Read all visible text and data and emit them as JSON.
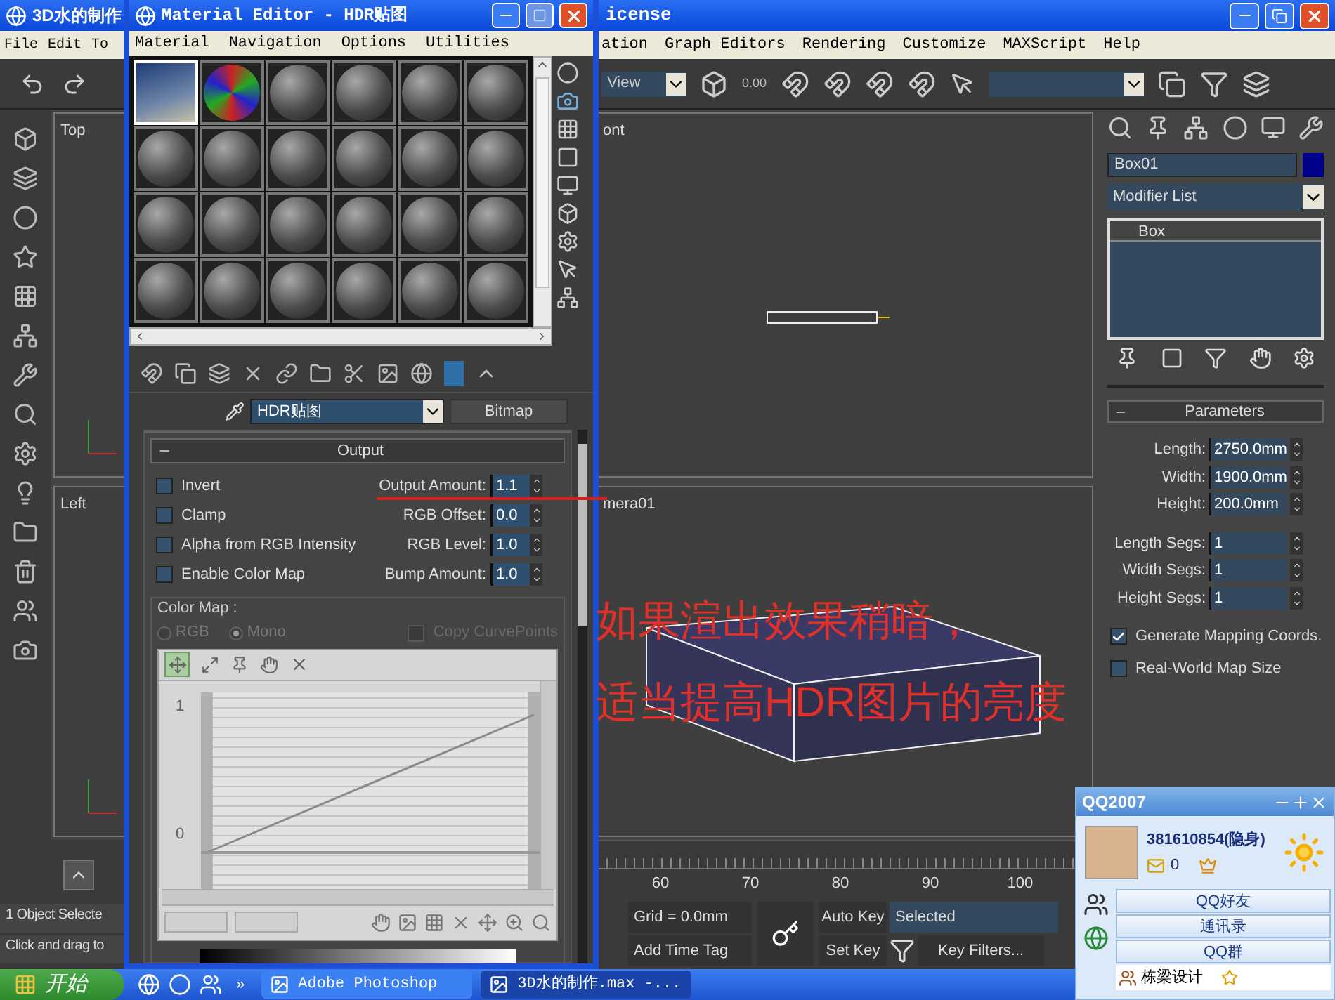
{
  "max_window": {
    "title_left": "3D水的制作",
    "title_right": "icense",
    "menu_left": [
      "File",
      "Edit",
      "To"
    ],
    "menu_right": [
      "ation",
      "Graph Editors",
      "Rendering",
      "Customize",
      "MAXScript",
      "Help"
    ],
    "view_dropdown": "View",
    "snap_value": "0.00"
  },
  "viewports": [
    {
      "label": "Top"
    },
    {
      "label": "ont"
    },
    {
      "label": "Left"
    },
    {
      "label": "mera01"
    }
  ],
  "command_panel": {
    "object_name": "Box01",
    "modifier_list": "Modifier List",
    "stack": [
      {
        "label": "Box",
        "selected": false
      }
    ],
    "rollout": "Parameters",
    "fields": [
      {
        "label": "Length:",
        "value": "2750.0mm"
      },
      {
        "label": "Width:",
        "value": "1900.0mm"
      },
      {
        "label": "Height:",
        "value": "200.0mm"
      },
      {
        "label": "Length Segs:",
        "value": "1"
      },
      {
        "label": "Width Segs:",
        "value": "1"
      },
      {
        "label": "Height Segs:",
        "value": "1"
      }
    ],
    "options": [
      {
        "label": "Generate Mapping Coords.",
        "checked": true
      },
      {
        "label": "Real-World Map Size",
        "checked": false
      }
    ]
  },
  "timeline": {
    "ticks": [
      "60",
      "70",
      "80",
      "90",
      "100"
    ]
  },
  "status": {
    "selection": "1 Object Selecte",
    "prompt": "Click and drag to",
    "grid": "Grid = 0.0mm",
    "time_tag": "Add Time Tag",
    "auto_key": "Auto Key",
    "set_key": "Set Key",
    "key_mode": "Selected",
    "key_filters": "Key Filters..."
  },
  "material_editor": {
    "title": "Material Editor - HDR贴图",
    "menu": [
      "Material",
      "Navigation",
      "Options",
      "Utilities"
    ],
    "slots": [
      {
        "kind": "photo",
        "selected": true
      },
      {
        "kind": "checker",
        "selected": false
      },
      {
        "kind": "sphere",
        "selected": false
      },
      {
        "kind": "sphere",
        "selected": false
      },
      {
        "kind": "sphere",
        "selected": false
      },
      {
        "kind": "sphere",
        "selected": false
      },
      {
        "kind": "sphere",
        "selected": false
      },
      {
        "kind": "sphere",
        "selected": false
      },
      {
        "kind": "sphere",
        "selected": false
      },
      {
        "kind": "sphere",
        "selected": false
      },
      {
        "kind": "sphere",
        "selected": false
      },
      {
        "kind": "sphere",
        "selected": false
      },
      {
        "kind": "sphere",
        "selected": false
      },
      {
        "kind": "sphere",
        "selected": false
      },
      {
        "kind": "sphere",
        "selected": false
      },
      {
        "kind": "sphere",
        "selected": false
      },
      {
        "kind": "sphere",
        "selected": false
      },
      {
        "kind": "sphere",
        "selected": false
      },
      {
        "kind": "sphere",
        "selected": false
      },
      {
        "kind": "sphere",
        "selected": false
      },
      {
        "kind": "sphere",
        "selected": false
      },
      {
        "kind": "sphere",
        "selected": false
      },
      {
        "kind": "sphere",
        "selected": false
      },
      {
        "kind": "sphere",
        "selected": false
      }
    ],
    "material_name": "HDR贴图",
    "map_type": "Bitmap",
    "rollout": "Output",
    "options": [
      {
        "label": "Invert",
        "checked": false
      },
      {
        "label": "Clamp",
        "checked": false
      },
      {
        "label": "Alpha from RGB Intensity",
        "checked": false
      },
      {
        "label": "Enable Color Map",
        "checked": false
      }
    ],
    "spinners": [
      {
        "label": "Output Amount:",
        "value": "1.1"
      },
      {
        "label": "RGB Offset:",
        "value": "0.0"
      },
      {
        "label": "RGB Level:",
        "value": "1.0"
      },
      {
        "label": "Bump Amount:",
        "value": "1.0"
      }
    ],
    "color_map": {
      "title": "Color Map :",
      "modes": [
        {
          "label": "RGB",
          "selected": false
        },
        {
          "label": "Mono",
          "selected": true
        }
      ],
      "copy_points": {
        "label": "Copy CurvePoints",
        "checked": false,
        "disabled": true
      }
    },
    "curve": {
      "top_label": "1",
      "bottom_label": "0"
    }
  },
  "annotation": {
    "lines": [
      "如果渲出效果稍暗，",
      "适当提高HDR图片的亮度"
    ]
  },
  "qq": {
    "title": "QQ2007",
    "user": "381610854(隐身)",
    "mail_count": "0",
    "buttons": [
      "QQ好友",
      "通讯录",
      "QQ群"
    ],
    "groups": [
      "栋梁设计"
    ]
  },
  "taskbar": {
    "start": "开始",
    "more": "»",
    "tasks": [
      {
        "label": "Adobe Photoshop",
        "selected": false
      },
      {
        "label": "3D水的制作.max -...",
        "selected": true
      }
    ]
  }
}
